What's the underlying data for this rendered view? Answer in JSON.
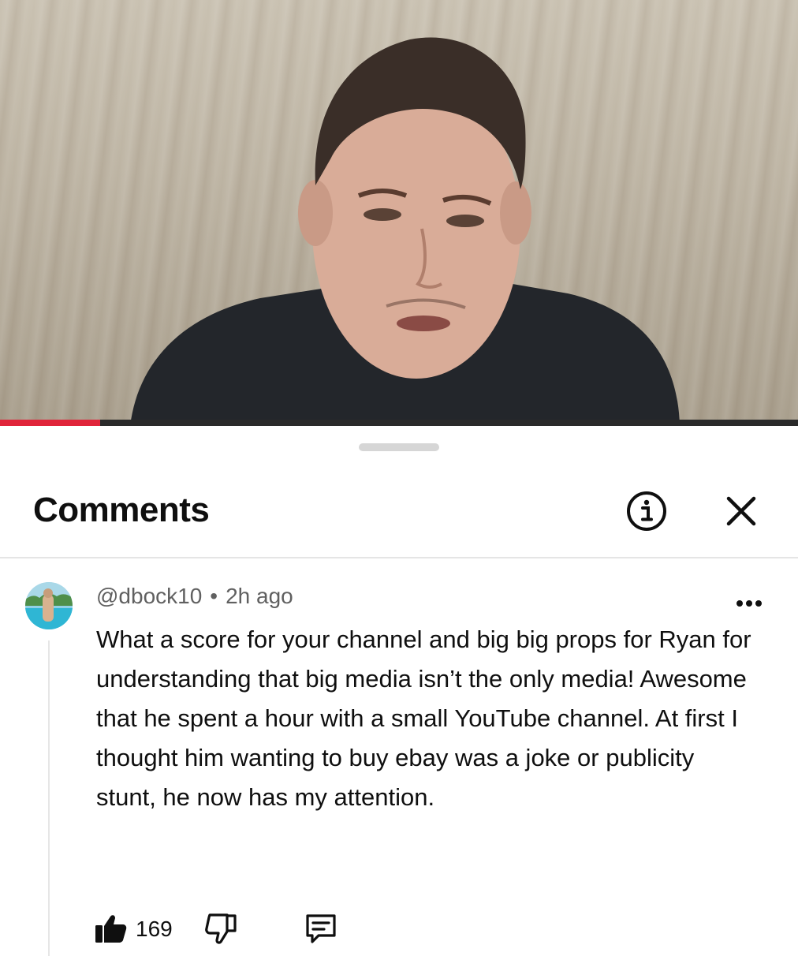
{
  "video": {
    "progress_fraction": 0.125,
    "progress_color": "#e0243a"
  },
  "comments_panel": {
    "title": "Comments",
    "icons": {
      "info": "info-icon",
      "close": "close-icon"
    }
  },
  "comment": {
    "author": "@dbock10",
    "separator": "•",
    "time": "2h ago",
    "text": "What a score for your channel and big big props for Ryan for understanding that big media isn’t the only media! Awesome that he spent a hour with a small YouTube channel. At first I thought him wanting to buy ebay was a joke or publicity stunt, he now has my attention.",
    "like_count": "169",
    "icons": {
      "more": "more-options-icon",
      "like": "thumbs-up-icon",
      "dislike": "thumbs-down-icon",
      "reply": "reply-icon"
    }
  }
}
